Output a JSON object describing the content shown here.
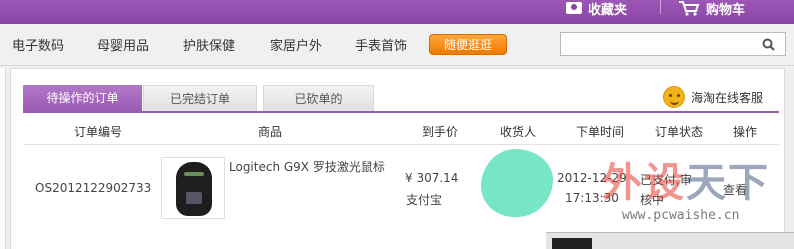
{
  "header": {
    "favorites_label": "收藏夹",
    "cart_label": "购物车"
  },
  "nav": {
    "items": [
      "电子数码",
      "母婴用品",
      "护肤保健",
      "家居户外",
      "手表首饰"
    ],
    "hot_label": "随便逛逛",
    "search_value": "",
    "search_placeholder": ""
  },
  "tabs": [
    {
      "label": "待操作的订单",
      "active": true
    },
    {
      "label": "已完结订单",
      "active": false
    },
    {
      "label": "已砍单的",
      "active": false
    }
  ],
  "service_label": "海淘在线客服",
  "table": {
    "columns": [
      "订单编号",
      "商品",
      "到手价",
      "收货人",
      "下单时间",
      "订单状态",
      "操作"
    ],
    "rows": [
      {
        "order_id": "OS2012122902733",
        "product_name": "Logitech G9X 罗技激光鼠标",
        "price": "¥ 307.14",
        "payment": "支付宝",
        "date": "2012-12-29",
        "time": "17:13:30",
        "status_line1": "已支付,审",
        "status_line2": "核中",
        "action": "查看"
      }
    ]
  },
  "watermark": {
    "text_red": "外设",
    "text_dark": "天下",
    "url": "www.pcwaishe.cn"
  },
  "colors": {
    "brand_purple": "#9a5bb3",
    "hot_orange": "#f07a00",
    "redaction_mint": "#76e6c6"
  }
}
